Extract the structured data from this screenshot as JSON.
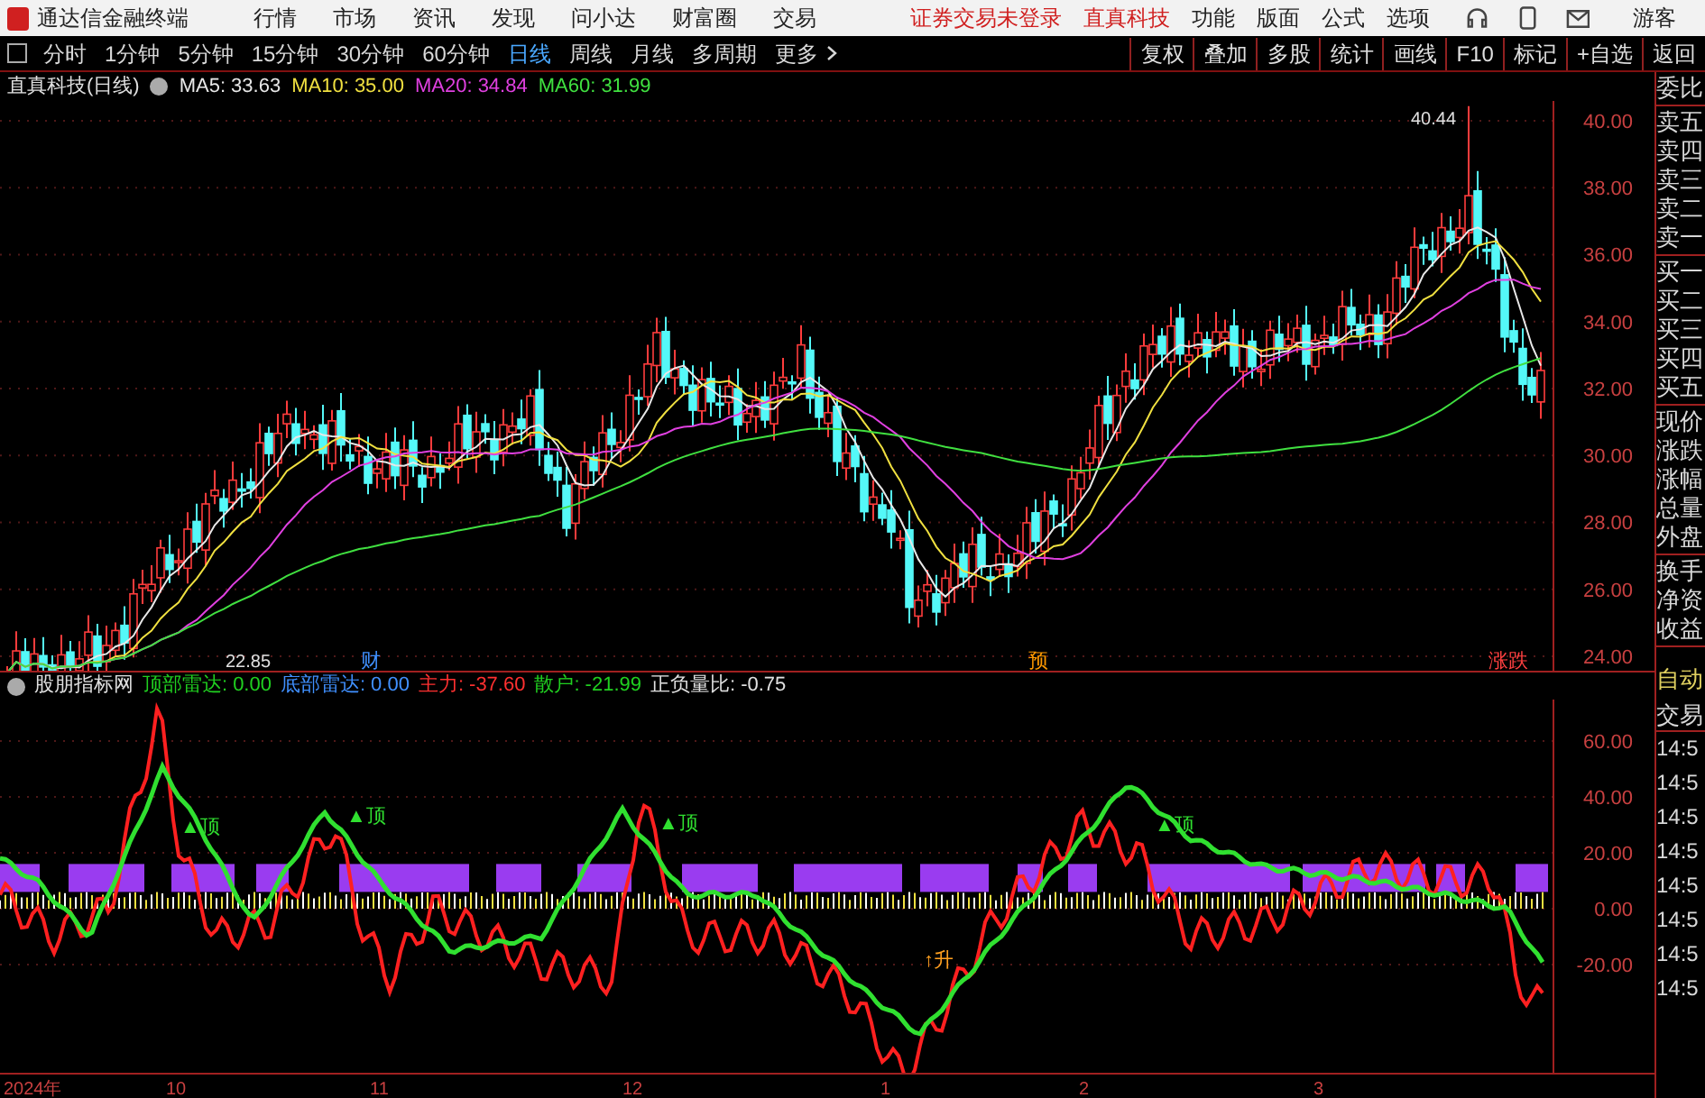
{
  "title_bar": {
    "app_name": "通达信金融终端",
    "menu": [
      "行情",
      "市场",
      "资讯",
      "发现",
      "问小达",
      "财富圈",
      "交易"
    ],
    "notice": "证券交易未登录",
    "stock": "直真科技",
    "tools": [
      "功能",
      "版面",
      "公式",
      "选项"
    ],
    "user": "游客"
  },
  "period_tabs": [
    {
      "label": "分时",
      "selected": false
    },
    {
      "label": "1分钟",
      "selected": false
    },
    {
      "label": "5分钟",
      "selected": false
    },
    {
      "label": "15分钟",
      "selected": false
    },
    {
      "label": "30分钟",
      "selected": false
    },
    {
      "label": "60分钟",
      "selected": false
    },
    {
      "label": "日线",
      "selected": true
    },
    {
      "label": "周线",
      "selected": false
    },
    {
      "label": "月线",
      "selected": false
    },
    {
      "label": "多周期",
      "selected": false
    },
    {
      "label": "更多",
      "selected": false
    }
  ],
  "tool_buttons": [
    "复权",
    "叠加",
    "多股",
    "统计",
    "画线",
    "F10",
    "标记",
    "+自选",
    "返回"
  ],
  "price_chart": {
    "title": "直真科技(日线)",
    "ma": [
      {
        "label": "MA5: 33.63",
        "color": "#e8e8e8"
      },
      {
        "label": "MA10: 35.00",
        "color": "#f0e040"
      },
      {
        "label": "MA20: 34.84",
        "color": "#e040e0"
      },
      {
        "label": "MA60: 31.99",
        "color": "#40e040"
      }
    ],
    "axis_labels": [
      "40.00",
      "38.00",
      "36.00",
      "34.00",
      "32.00",
      "30.00",
      "28.00",
      "26.00",
      "24.00"
    ],
    "high_label": "40.44",
    "low_label": "22.85",
    "markers": [
      {
        "text": "财",
        "color": "#4090ff"
      },
      {
        "text": "预",
        "color": "#ff9900"
      },
      {
        "text": "涨跌",
        "color": "#ff4040"
      }
    ]
  },
  "indicator": {
    "name": "股朋指标网",
    "fields": [
      {
        "label": "顶部雷达:",
        "value": "0.00",
        "color": "#20d020"
      },
      {
        "label": "底部雷达:",
        "value": "0.00",
        "color": "#4090ff"
      },
      {
        "label": "主力:",
        "value": "-37.60",
        "color": "#ff3030"
      },
      {
        "label": "散户:",
        "value": "-21.99",
        "color": "#20d020"
      },
      {
        "label": "正负量比:",
        "value": "-0.75",
        "color": "#e0e0e0"
      }
    ],
    "axis_labels": [
      "60.00",
      "40.00",
      "20.00",
      "0.00",
      "-20.00"
    ],
    "signals": [
      {
        "text": "▲顶",
        "kind": "top"
      },
      {
        "text": "▲顶",
        "kind": "top"
      },
      {
        "text": "▲顶",
        "kind": "top"
      },
      {
        "text": "▲顶",
        "kind": "top"
      },
      {
        "text": "↑升",
        "kind": "rise"
      }
    ]
  },
  "date_axis": [
    "2024年",
    "10",
    "11",
    "12",
    "1",
    "2",
    "3"
  ],
  "quote_panel": {
    "groups": [
      [
        "委比"
      ],
      [
        "卖五",
        "卖四",
        "卖三",
        "卖二",
        "卖一"
      ],
      [
        "买一",
        "买二",
        "买三",
        "买四",
        "买五"
      ],
      [
        "现价",
        "涨跌",
        "涨幅",
        "总量",
        "外盘"
      ],
      [
        "换手",
        "净资",
        "收益"
      ]
    ],
    "auto": "自动",
    "trade": "交易",
    "times": [
      "14:5",
      "14:5",
      "14:5",
      "14:5",
      "14:5",
      "14:5",
      "14:5",
      "14:5"
    ]
  }
}
